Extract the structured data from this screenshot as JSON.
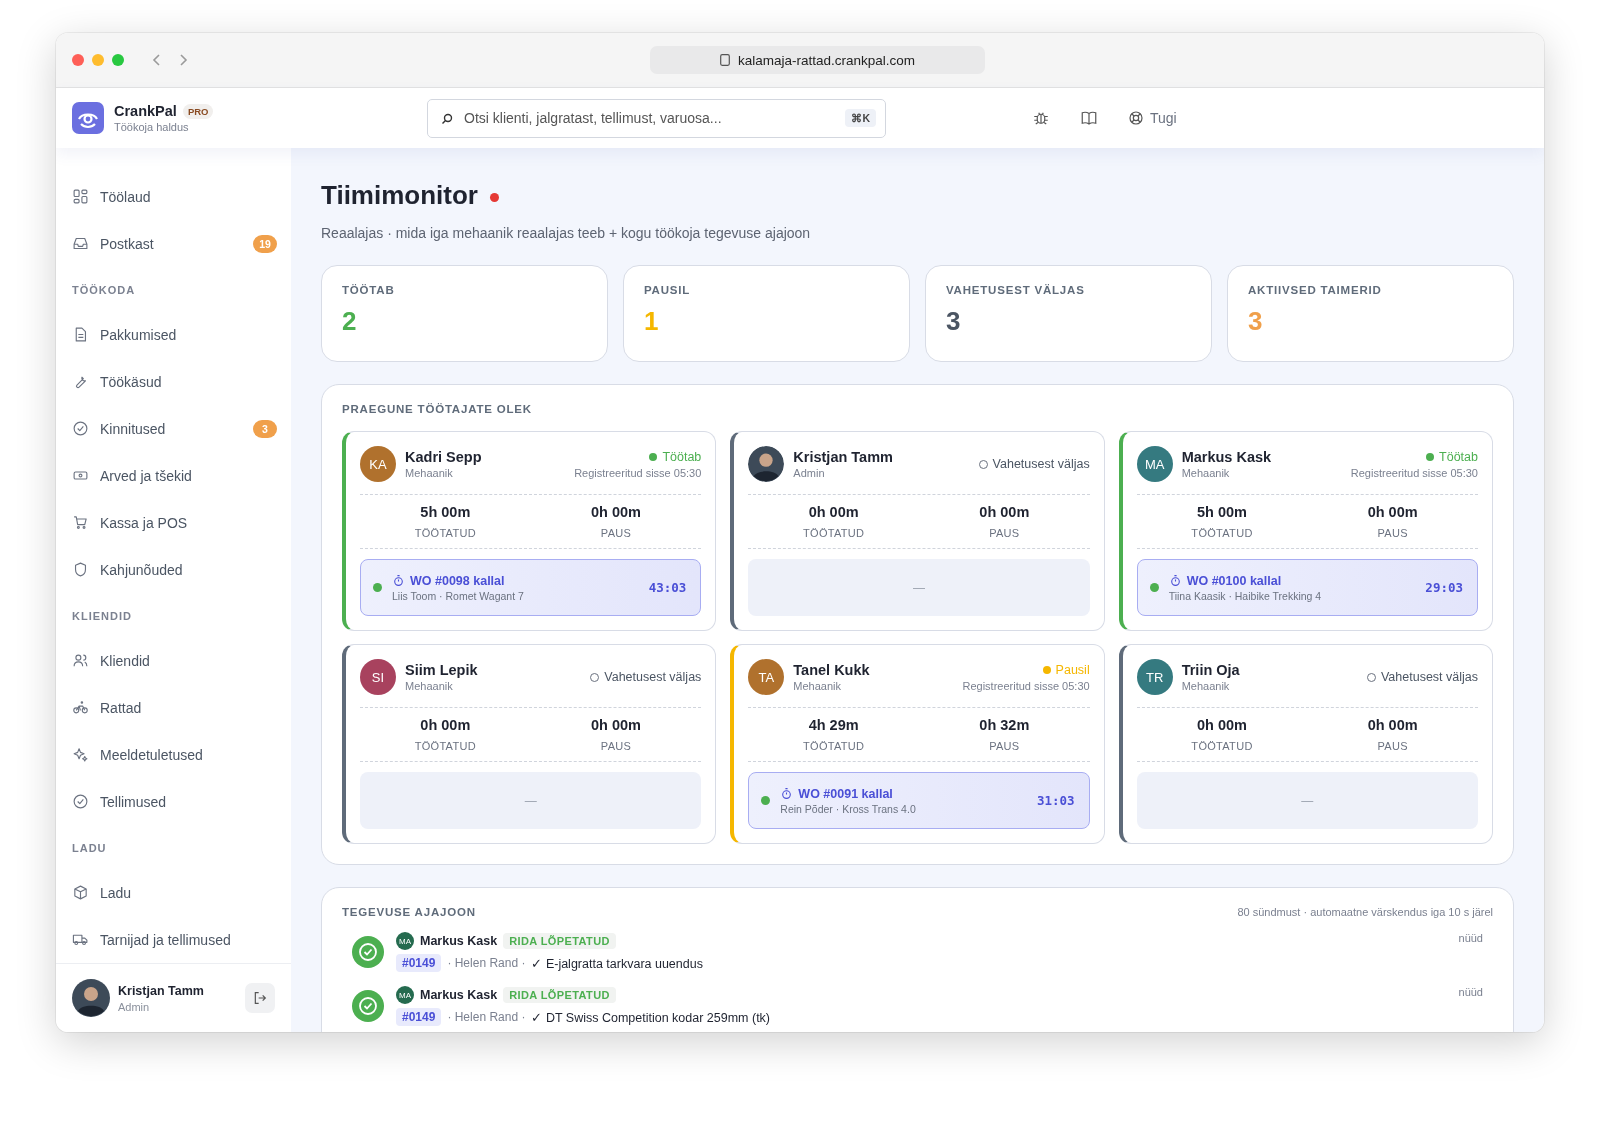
{
  "browser": {
    "url": "kalamaja-rattad.crankpal.com"
  },
  "brand": {
    "name": "CrankPal",
    "badge": "PRO",
    "subtitle": "Töökoja haldus"
  },
  "search": {
    "placeholder": "Otsi klienti, jalgratast, tellimust, varuosa...",
    "shortcut": "⌘K"
  },
  "support": {
    "label": "Tugi"
  },
  "sidebar": {
    "sections": [
      {
        "items": [
          {
            "label": "Töölaud"
          },
          {
            "label": "Postkast",
            "badge": "19"
          }
        ]
      },
      {
        "title": "TÖÖKODA",
        "items": [
          {
            "label": "Pakkumised"
          },
          {
            "label": "Töökäsud"
          },
          {
            "label": "Kinnitused",
            "badge": "3"
          },
          {
            "label": "Arved ja tšekid"
          },
          {
            "label": "Kassa ja POS"
          },
          {
            "label": "Kahjunõuded"
          }
        ]
      },
      {
        "title": "KLIENDID",
        "items": [
          {
            "label": "Kliendid"
          },
          {
            "label": "Rattad"
          },
          {
            "label": "Meeldetuletused"
          },
          {
            "label": "Tellimused"
          }
        ]
      },
      {
        "title": "LADU",
        "items": [
          {
            "label": "Ladu"
          },
          {
            "label": "Tarnijad ja tellimused"
          }
        ]
      }
    ]
  },
  "user": {
    "name": "Kristjan Tamm",
    "role": "Admin"
  },
  "page": {
    "title": "Tiimimonitor",
    "live": true,
    "subtitle": "Reaalajas · mida iga mehaanik reaalajas teeb + kogu töökoja tegevuse ajajoon"
  },
  "stats": [
    {
      "label": "TÖÖTAB",
      "value": "2",
      "color": "#4caf50"
    },
    {
      "label": "PAUSIL",
      "value": "1",
      "color": "#f5b700"
    },
    {
      "label": "VAHETUSEST VÄLJAS",
      "value": "3",
      "color": "#4b5563"
    },
    {
      "label": "AKTIIVSED TAIMERID",
      "value": "3",
      "color": "#f0a04b"
    }
  ],
  "status_panel": {
    "title": "PRAEGUNE TÖÖTAJATE OLEK",
    "workers": [
      {
        "kind": "working",
        "avatar": {
          "kind": "initials",
          "text": "KA",
          "color": "#b0712d"
        },
        "name": "Kadri Sepp",
        "role": "Mehaanik",
        "status_label": "Töötab",
        "checked_in": "Registreeritud sisse 05:30",
        "worked": "5h 00m",
        "worked_label": "TÖÖTATUD",
        "pause": "0h 00m",
        "pause_label": "PAUS",
        "job": {
          "title": "WO #0098 kallal",
          "detail": "Liis Toom · Romet Wagant 7",
          "timer": "43:03"
        }
      },
      {
        "kind": "off",
        "name": "Kristjan Tamm",
        "role": "Admin",
        "status_label": "Vahetusest väljas",
        "worked": "0h 00m",
        "worked_label": "TÖÖTATUD",
        "pause": "0h 00m",
        "pause_label": "PAUS",
        "no_job": "—"
      },
      {
        "kind": "working",
        "avatar": {
          "kind": "initials",
          "text": "MA",
          "color": "#357a80"
        },
        "name": "Markus Kask",
        "role": "Mehaanik",
        "status_label": "Töötab",
        "checked_in": "Registreeritud sisse 05:30",
        "worked": "5h 00m",
        "worked_label": "TÖÖTATUD",
        "pause": "0h 00m",
        "pause_label": "PAUS",
        "job": {
          "title": "WO #0100 kallal",
          "detail": "Tiina Kaasik · Haibike Trekking 4",
          "timer": "29:03"
        }
      },
      {
        "kind": "off",
        "avatar": {
          "kind": "initials",
          "text": "SI",
          "color": "#a8425e"
        },
        "name": "Siim Lepik",
        "role": "Mehaanik",
        "status_label": "Vahetusest väljas",
        "worked": "0h 00m",
        "worked_label": "TÖÖTATUD",
        "pause": "0h 00m",
        "pause_label": "PAUS",
        "no_job": "—"
      },
      {
        "kind": "paused",
        "avatar": {
          "kind": "initials",
          "text": "TA",
          "color": "#b0712d"
        },
        "name": "Tanel Kukk",
        "role": "Mehaanik",
        "status_label": "Pausil",
        "checked_in": "Registreeritud sisse 05:30",
        "worked": "4h 29m",
        "worked_label": "TÖÖTATUD",
        "pause": "0h 32m",
        "pause_label": "PAUS",
        "job": {
          "title": "WO #0091 kallal",
          "detail": "Rein Põder · Kross Trans 4.0",
          "timer": "31:03"
        }
      },
      {
        "kind": "off",
        "avatar": {
          "kind": "initials",
          "text": "TR",
          "color": "#357a80"
        },
        "name": "Triin Oja",
        "role": "Mehaanik",
        "status_label": "Vahetusest väljas",
        "worked": "0h 00m",
        "worked_label": "TÖÖTATUD",
        "pause": "0h 00m",
        "pause_label": "PAUS",
        "no_job": "—"
      }
    ]
  },
  "timeline": {
    "title": "TEGEVUSE AJAJOON",
    "meta": "80 sündmust · automaatne värskendus iga 10 s järel",
    "events": [
      {
        "initials": "MA",
        "actor": "Markus Kask",
        "tag": "RIDA LÕPETATUD",
        "order": "#0149",
        "customer": "· Helen Rand ·",
        "item": "✓ E-jalgratta tarkvara uuendus",
        "time": "nüüd"
      },
      {
        "initials": "MA",
        "actor": "Markus Kask",
        "tag": "RIDA LÕPETATUD",
        "order": "#0149",
        "customer": "· Helen Rand ·",
        "item": "✓ DT Swiss Competition kodar 259mm (tk)",
        "time": "nüüd"
      }
    ]
  }
}
